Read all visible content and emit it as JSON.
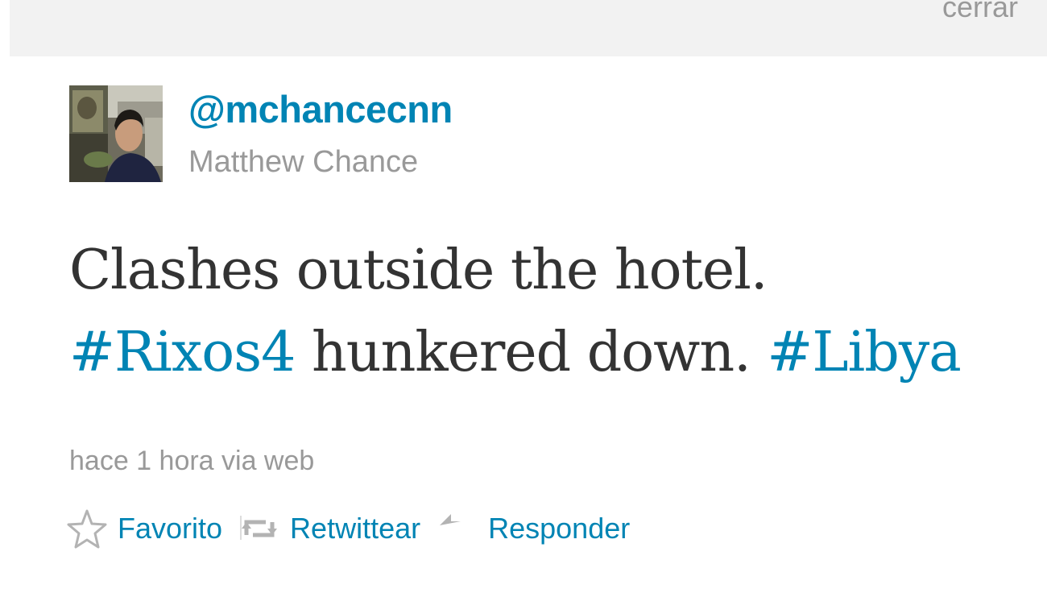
{
  "header": {
    "close_label": "cerrar"
  },
  "tweet": {
    "screen_name": "@mchancecnn",
    "full_name": "Matthew Chance",
    "text_part1": "Clashes outside the hotel.",
    "hashtag1": "#Rixos4",
    "text_part2": " hunkered down. ",
    "hashtag2": "#Libya",
    "meta": "hace 1 hora via web"
  },
  "actions": {
    "favorite": "Favorito",
    "retweet": "Retwittear",
    "reply": "Responder"
  },
  "colors": {
    "link": "#0084b4",
    "muted": "#999999",
    "text": "#333333",
    "topbar_bg": "#f2f2f2"
  }
}
